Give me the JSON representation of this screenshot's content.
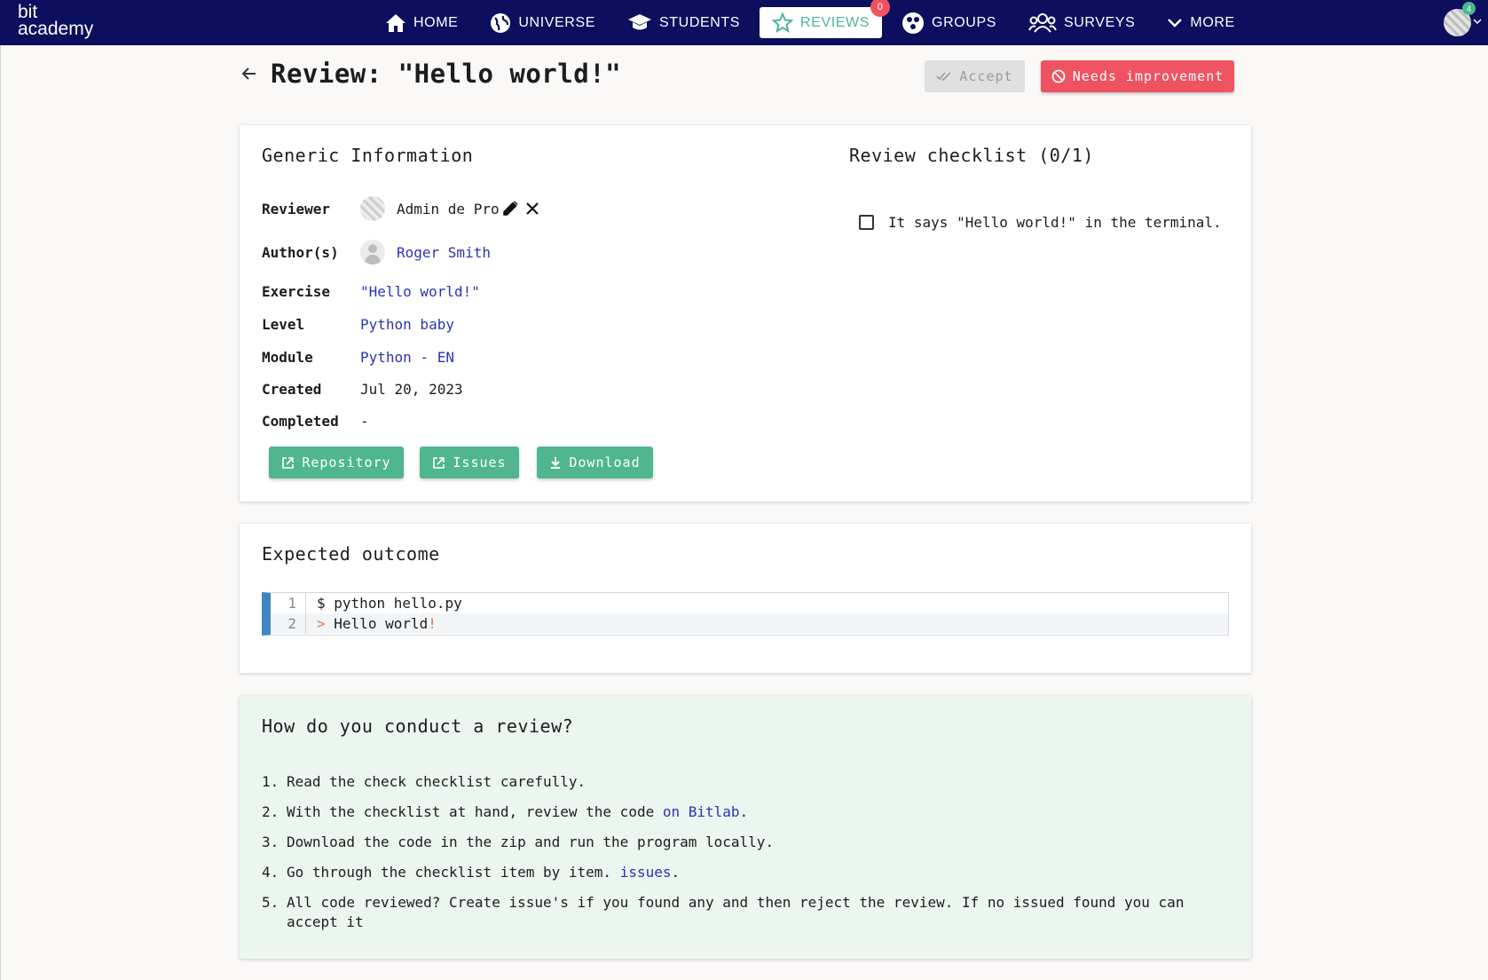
{
  "brand": {
    "line1": "bit",
    "line2": "academy"
  },
  "nav": {
    "items": [
      {
        "label": "HOME",
        "icon": "home-icon"
      },
      {
        "label": "UNIVERSE",
        "icon": "globe-icon"
      },
      {
        "label": "STUDENTS",
        "icon": "graduation-cap-icon"
      },
      {
        "label": "REVIEWS",
        "icon": "star-icon",
        "active": true,
        "badge": "0"
      },
      {
        "label": "GROUPS",
        "icon": "groups-icon"
      },
      {
        "label": "SURVEYS",
        "icon": "people-icon"
      },
      {
        "label": "MORE",
        "icon": "chevron-down-icon"
      }
    ],
    "user_badge": "4"
  },
  "header": {
    "title": "Review: \"Hello world!\"",
    "accept_label": "Accept",
    "needs_improvement_label": "Needs improvement"
  },
  "info": {
    "heading": "Generic Information",
    "reviewer_label": "Reviewer",
    "reviewer_name": "Admin de Pro",
    "authors_label": "Author(s)",
    "author_name": "Roger Smith",
    "exercise_label": "Exercise",
    "exercise_value": "\"Hello world!\"",
    "level_label": "Level",
    "level_value": "Python baby",
    "module_label": "Module",
    "module_value": "Python - EN",
    "created_label": "Created",
    "created_value": "Jul 20, 2023",
    "completed_label": "Completed",
    "completed_value": "-",
    "buttons": {
      "repository": "Repository",
      "issues": "Issues",
      "download": "Download"
    }
  },
  "checklist": {
    "heading": "Review checklist (0/1)",
    "items": [
      {
        "label": "It says \"Hello world!\" in the terminal.",
        "checked": false
      }
    ]
  },
  "outcome": {
    "heading": "Expected outcome",
    "lines": [
      {
        "num": "1",
        "prefix": "$",
        "text": "python hello.py"
      },
      {
        "num": "2",
        "prefix": ">",
        "text": "Hello world",
        "suffix": "!"
      }
    ]
  },
  "howto": {
    "heading": "How do you conduct a review?",
    "steps": [
      {
        "num": "1.",
        "text": "Read the check checklist carefully."
      },
      {
        "num": "2.",
        "text_before": "With the checklist at hand, review the code ",
        "link": "on Bitlab",
        "text_after": "."
      },
      {
        "num": "3.",
        "text": "Download the code in the zip and run the program locally."
      },
      {
        "num": "4.",
        "text_before": "Go through the checklist item by item. ",
        "link": "issues",
        "text_after": "."
      },
      {
        "num": "5.",
        "text": "All code reviewed? Create issue's if you found any and then reject the review. If no issued found you can accept it"
      }
    ]
  },
  "colors": {
    "navbar": "#0b0f5e",
    "accent_green": "#4fb68f",
    "danger": "#ef5261",
    "link": "#2b33b5",
    "howto_bg": "#eaf6ef"
  }
}
